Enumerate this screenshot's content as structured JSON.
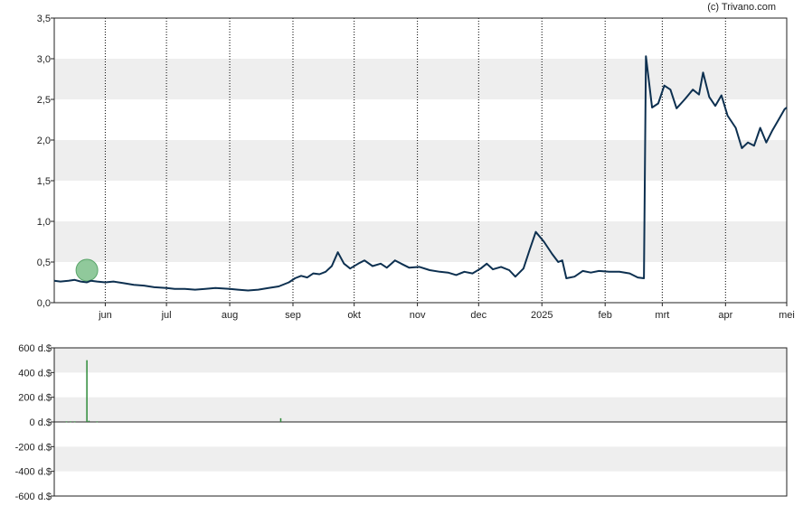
{
  "credit": "(c) Trivano.com",
  "colors": {
    "line": "#0d3050",
    "band": "#eeeeee",
    "volume_bar": "#2e8b3a",
    "marker": "#7cbf8a",
    "axis": "#222222",
    "gridline": "#000000"
  },
  "chart_data": [
    {
      "type": "line",
      "title": "",
      "xlabel": "",
      "ylabel": "",
      "x_ticks": [
        "jun",
        "jul",
        "aug",
        "sep",
        "okt",
        "nov",
        "dec",
        "2025",
        "feb",
        "mrt",
        "apr",
        "mei"
      ],
      "y_ticks": [
        "0,0",
        "0,5",
        "1,0",
        "1,5",
        "2,0",
        "2,5",
        "3,0",
        "3,5"
      ],
      "ylim": [
        0,
        3.5
      ],
      "xlim": [
        "2024-05-07",
        "2025-05-01"
      ],
      "grid": "vertical dotted at month starts, alternating horizontal bands",
      "marker": {
        "x": "2024-05-23",
        "y": 0.4
      },
      "series": [
        {
          "points": [
            [
              "2024-05-07",
              0.27
            ],
            [
              "2024-05-10",
              0.26
            ],
            [
              "2024-05-14",
              0.27
            ],
            [
              "2024-05-17",
              0.28
            ],
            [
              "2024-05-20",
              0.26
            ],
            [
              "2024-05-23",
              0.25
            ],
            [
              "2024-05-25",
              0.27
            ],
            [
              "2024-05-28",
              0.26
            ],
            [
              "2024-06-01",
              0.25
            ],
            [
              "2024-06-05",
              0.26
            ],
            [
              "2024-06-10",
              0.24
            ],
            [
              "2024-06-15",
              0.22
            ],
            [
              "2024-06-20",
              0.21
            ],
            [
              "2024-06-25",
              0.19
            ],
            [
              "2024-07-01",
              0.18
            ],
            [
              "2024-07-05",
              0.17
            ],
            [
              "2024-07-10",
              0.17
            ],
            [
              "2024-07-15",
              0.16
            ],
            [
              "2024-07-20",
              0.17
            ],
            [
              "2024-07-25",
              0.18
            ],
            [
              "2024-08-01",
              0.17
            ],
            [
              "2024-08-05",
              0.16
            ],
            [
              "2024-08-10",
              0.15
            ],
            [
              "2024-08-15",
              0.16
            ],
            [
              "2024-08-20",
              0.18
            ],
            [
              "2024-08-25",
              0.2
            ],
            [
              "2024-08-30",
              0.25
            ],
            [
              "2024-09-02",
              0.3
            ],
            [
              "2024-09-05",
              0.33
            ],
            [
              "2024-09-08",
              0.31
            ],
            [
              "2024-09-11",
              0.36
            ],
            [
              "2024-09-14",
              0.35
            ],
            [
              "2024-09-17",
              0.38
            ],
            [
              "2024-09-20",
              0.45
            ],
            [
              "2024-09-23",
              0.62
            ],
            [
              "2024-09-26",
              0.48
            ],
            [
              "2024-09-29",
              0.42
            ],
            [
              "2024-10-03",
              0.48
            ],
            [
              "2024-10-06",
              0.52
            ],
            [
              "2024-10-10",
              0.45
            ],
            [
              "2024-10-14",
              0.48
            ],
            [
              "2024-10-17",
              0.43
            ],
            [
              "2024-10-21",
              0.52
            ],
            [
              "2024-10-24",
              0.48
            ],
            [
              "2024-10-28",
              0.43
            ],
            [
              "2024-11-02",
              0.44
            ],
            [
              "2024-11-07",
              0.4
            ],
            [
              "2024-11-12",
              0.38
            ],
            [
              "2024-11-16",
              0.37
            ],
            [
              "2024-11-20",
              0.34
            ],
            [
              "2024-11-24",
              0.38
            ],
            [
              "2024-11-28",
              0.36
            ],
            [
              "2024-12-02",
              0.42
            ],
            [
              "2024-12-05",
              0.48
            ],
            [
              "2024-12-08",
              0.41
            ],
            [
              "2024-12-12",
              0.44
            ],
            [
              "2024-12-16",
              0.4
            ],
            [
              "2024-12-19",
              0.32
            ],
            [
              "2024-12-23",
              0.42
            ],
            [
              "2024-12-26",
              0.65
            ],
            [
              "2024-12-29",
              0.87
            ],
            [
              "2025-01-02",
              0.75
            ],
            [
              "2025-01-06",
              0.6
            ],
            [
              "2025-01-09",
              0.5
            ],
            [
              "2025-01-11",
              0.52
            ],
            [
              "2025-01-13",
              0.3
            ],
            [
              "2025-01-17",
              0.32
            ],
            [
              "2025-01-21",
              0.39
            ],
            [
              "2025-01-25",
              0.37
            ],
            [
              "2025-01-29",
              0.39
            ],
            [
              "2025-02-03",
              0.38
            ],
            [
              "2025-02-08",
              0.38
            ],
            [
              "2025-02-13",
              0.36
            ],
            [
              "2025-02-17",
              0.31
            ],
            [
              "2025-02-20",
              0.3
            ],
            [
              "2025-02-21",
              3.03
            ],
            [
              "2025-02-24",
              2.4
            ],
            [
              "2025-02-27",
              2.45
            ],
            [
              "2025-03-02",
              2.67
            ],
            [
              "2025-03-05",
              2.62
            ],
            [
              "2025-03-08",
              2.39
            ],
            [
              "2025-03-12",
              2.5
            ],
            [
              "2025-03-16",
              2.62
            ],
            [
              "2025-03-19",
              2.56
            ],
            [
              "2025-03-21",
              2.83
            ],
            [
              "2025-03-24",
              2.53
            ],
            [
              "2025-03-27",
              2.42
            ],
            [
              "2025-03-30",
              2.55
            ],
            [
              "2025-04-02",
              2.3
            ],
            [
              "2025-04-06",
              2.15
            ],
            [
              "2025-04-09",
              1.9
            ],
            [
              "2025-04-12",
              1.97
            ],
            [
              "2025-04-15",
              1.93
            ],
            [
              "2025-04-18",
              2.15
            ],
            [
              "2025-04-21",
              1.97
            ],
            [
              "2025-04-24",
              2.12
            ],
            [
              "2025-04-27",
              2.25
            ],
            [
              "2025-04-30",
              2.38
            ],
            [
              "2025-05-01",
              2.4
            ]
          ]
        }
      ]
    },
    {
      "type": "bar",
      "title": "",
      "y_ticks": [
        "600 d.$",
        "400 d.$",
        "200 d.$",
        "0 d.$",
        "-200 d.$",
        "-400 d.$",
        "-600 d.$"
      ],
      "ylim": [
        -600,
        600
      ],
      "xlim": [
        "2024-05-07",
        "2025-05-01"
      ],
      "grid": "alternating horizontal bands, solid zero line",
      "bars": [
        {
          "x": "2024-05-13",
          "value": 5
        },
        {
          "x": "2024-05-15",
          "value": 5
        },
        {
          "x": "2024-05-17",
          "value": 5
        },
        {
          "x": "2024-05-23",
          "value": 500
        },
        {
          "x": "2024-05-24",
          "value": 10
        },
        {
          "x": "2024-05-28",
          "value": 5
        },
        {
          "x": "2024-08-26",
          "value": 30
        }
      ]
    }
  ]
}
